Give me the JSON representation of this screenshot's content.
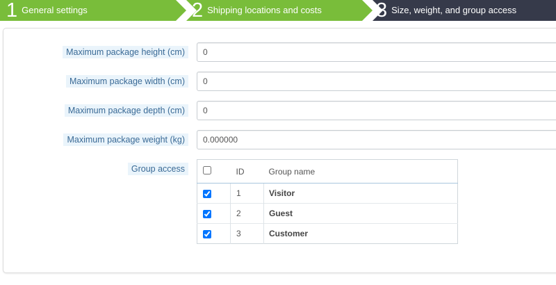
{
  "wizard": {
    "steps": [
      {
        "number": "1",
        "label": "General settings",
        "color": "#79bd3a"
      },
      {
        "number": "2",
        "label": "Shipping locations and costs",
        "color": "#79bd3a"
      },
      {
        "number": "3",
        "label": "Size, weight, and group access",
        "color": "#363a4a"
      }
    ]
  },
  "form": {
    "max_height": {
      "label": "Maximum package height (cm)",
      "value": "0"
    },
    "max_width": {
      "label": "Maximum package width (cm)",
      "value": "0"
    },
    "max_depth": {
      "label": "Maximum package depth (cm)",
      "value": "0"
    },
    "max_weight": {
      "label": "Maximum package weight (kg)",
      "value": "0.000000"
    },
    "group_access": {
      "label": "Group access",
      "select_all_checked": false,
      "columns": {
        "id": "ID",
        "name": "Group name"
      },
      "rows": [
        {
          "id": "1",
          "name": "Visitor",
          "checked": true
        },
        {
          "id": "2",
          "name": "Guest",
          "checked": true
        },
        {
          "id": "3",
          "name": "Customer",
          "checked": true
        }
      ]
    }
  },
  "colors": {
    "step_done": "#79bd3a",
    "step_active": "#363a4a",
    "label_bg": "#eaf4fb",
    "label_text": "#3a6a96"
  }
}
